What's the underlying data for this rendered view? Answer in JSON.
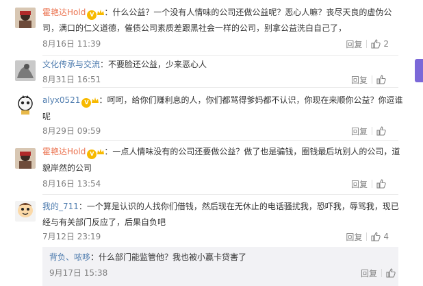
{
  "comments": [
    {
      "user": "霍艳达Hold",
      "text1": "：什么公益？一个没有人情味的公司还做公益呢？恶心人嘛？丧尽天良的虚伪公",
      "text2": "司，满口的仁义道德，催债公司素质差跟黑社会一样的公司，别拿公益洗白自己了，",
      "time": "8月16日 11:39",
      "reply": "回复",
      "likes": "2"
    },
    {
      "user": "文化传承与交流",
      "text1": "：不要脸还公益，少来恶心人",
      "time": "8月31日 16:51",
      "reply": "回复",
      "likes": ""
    },
    {
      "user": "alyx0521",
      "text1": "：呵呵，给你们赚利息的人，你们都骂得爹妈都不认识，你现在来顺你公益？你逗谁",
      "text2": "呢",
      "time": "8月29日 09:59",
      "reply": "回复",
      "likes": ""
    },
    {
      "user": "霍艳达Hold",
      "text1": "：一点人情味没有的公司还要做公益？做了也是骗钱，圈钱最后坑别人的公司，道",
      "text2": "貌岸然的公司",
      "time": "8月16日 13:54",
      "reply": "回复",
      "likes": ""
    },
    {
      "user": "我的_711",
      "text1": "：一个算是认识的人找你们借钱，然后现在无休止的电话骚扰我，恐吓我，辱骂我，现已",
      "text2": "经与有关部门反应了，后果自负吧",
      "time": "7月12日 23:19",
      "reply": "回复",
      "likes": "4"
    }
  ],
  "subreply": {
    "user": "背负、哝哆",
    "text": "：什么部门能监管他？我也被小赢卡贷害了",
    "time": "9月17日 15:38",
    "reply": "回复",
    "likes": ""
  },
  "colors": {
    "username_orange": "#eb7350",
    "username_blue": "#507daf",
    "meta_gray": "#808080",
    "accent_purple": "#7b68d8"
  },
  "icons": {
    "like": "thumbs-up-icon",
    "vip": "vip-badge-icon",
    "crown": "crown-icon"
  }
}
